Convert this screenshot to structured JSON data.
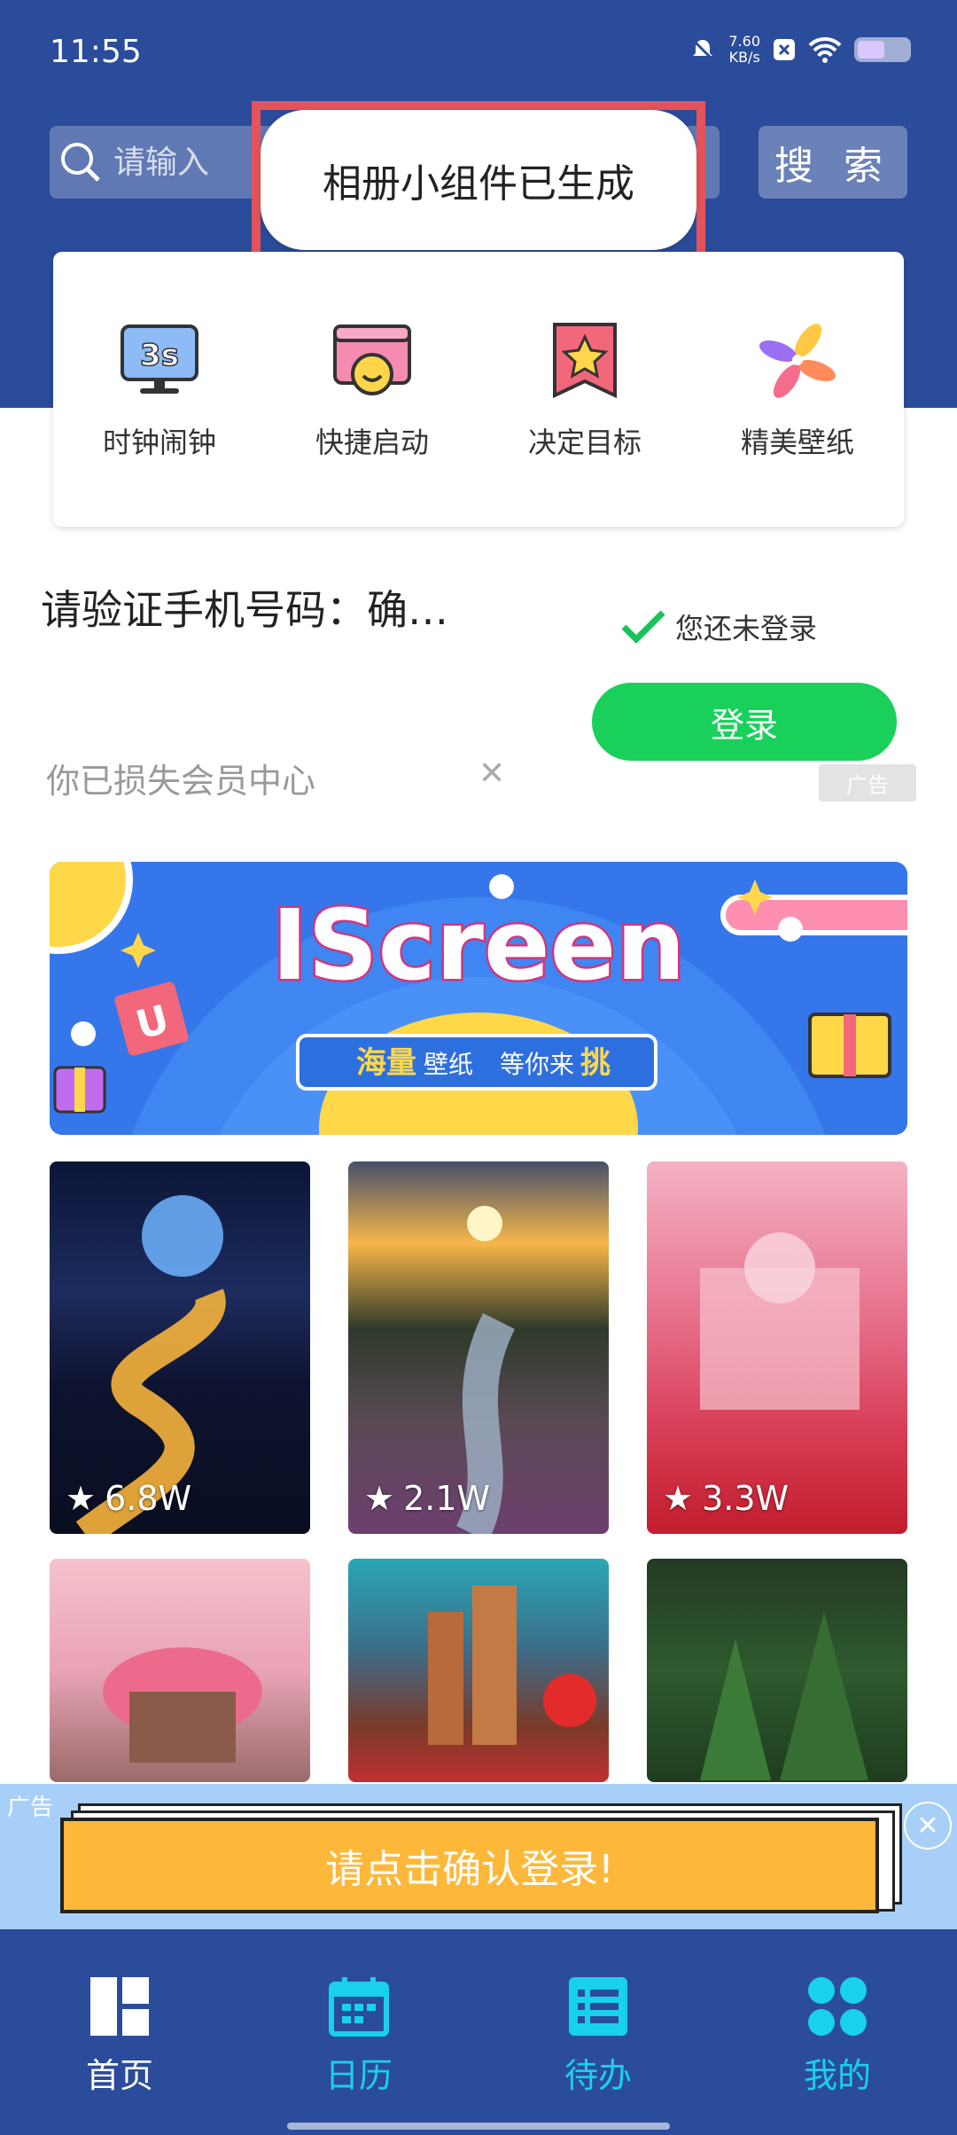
{
  "status": {
    "time": "11:55",
    "net_speed": "7.60",
    "net_unit": "KB/s"
  },
  "search": {
    "placeholder": "请输入",
    "button": "搜 索"
  },
  "toast": "相册小组件已生成",
  "quick_actions": [
    {
      "label": "时钟闹钟",
      "icon": "clock-monitor-icon",
      "badge": "3s"
    },
    {
      "label": "快捷启动",
      "icon": "smiley-launcher-icon"
    },
    {
      "label": "决定目标",
      "icon": "star-flag-icon"
    },
    {
      "label": "精美壁纸",
      "icon": "pinwheel-icon"
    }
  ],
  "verify_text": "请验证手机号码：确…",
  "login_status": "您还未登录",
  "login_button": "登录",
  "lost_text": "你已损失会员中心",
  "ad_label": "广告",
  "banner": {
    "title": "IScreen",
    "tagline_1": "海量",
    "tagline_2": "壁纸",
    "tagline_3": "等你来",
    "tagline_4": "挑"
  },
  "wallpapers": [
    {
      "count": "6.8W",
      "theme": "moon-river"
    },
    {
      "count": "2.1W",
      "theme": "sunset-stream"
    },
    {
      "count": "3.3W",
      "theme": "pink-castle"
    },
    {
      "count": "",
      "theme": "mushroom-house"
    },
    {
      "count": "",
      "theme": "fantasy-castle"
    },
    {
      "count": "",
      "theme": "forest"
    }
  ],
  "bottom_ad": {
    "label": "广告",
    "button": "请点击确认登录!"
  },
  "nav": [
    {
      "label": "首页",
      "icon": "home-grid-icon",
      "active": true
    },
    {
      "label": "日历",
      "icon": "calendar-icon",
      "active": false
    },
    {
      "label": "待办",
      "icon": "list-icon",
      "active": false
    },
    {
      "label": "我的",
      "icon": "four-petal-icon",
      "active": false
    }
  ],
  "colors": {
    "header": "#2b4c9b",
    "accent_cyan": "#19d0ee",
    "login_green": "#19d15a",
    "toast_border": "#e5535a",
    "ad_button": "#fdb83a"
  }
}
